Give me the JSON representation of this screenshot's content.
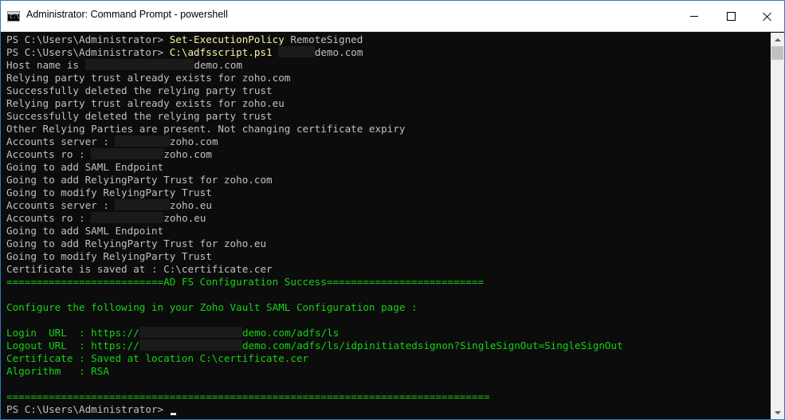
{
  "window": {
    "title": "Administrator: Command Prompt - powershell",
    "icon": "cmd-icon",
    "icon_text": "C:\\"
  },
  "lines": [
    {
      "segments": [
        {
          "text": "PS C:\\Users\\Administrator> "
        },
        {
          "text": "Set-ExecutionPolicy",
          "color": "yellow"
        },
        {
          "text": " RemoteSigned"
        }
      ]
    },
    {
      "segments": [
        {
          "text": "PS C:\\Users\\Administrator> "
        },
        {
          "text": "C:\\adfsscript.ps1",
          "color": "yellow"
        },
        {
          "text": " "
        },
        {
          "redact": 6
        },
        {
          "text": "demo.com"
        }
      ]
    },
    {
      "segments": [
        {
          "text": "Host name is "
        },
        {
          "redact": 18
        },
        {
          "text": "demo.com"
        }
      ]
    },
    {
      "segments": [
        {
          "text": "Relying party trust already exists for zoho.com"
        }
      ]
    },
    {
      "segments": [
        {
          "text": "Successfully deleted the relying party trust"
        }
      ]
    },
    {
      "segments": [
        {
          "text": "Relying party trust already exists for zoho.eu"
        }
      ]
    },
    {
      "segments": [
        {
          "text": "Successfully deleted the relying party trust"
        }
      ]
    },
    {
      "segments": [
        {
          "text": "Other Relying Parties are present. Not changing certificate expiry"
        }
      ]
    },
    {
      "segments": [
        {
          "text": "Accounts server : "
        },
        {
          "redact": 9
        },
        {
          "text": "zoho.com"
        }
      ]
    },
    {
      "segments": [
        {
          "text": "Accounts ro : "
        },
        {
          "redact": 12
        },
        {
          "text": "zoho.com"
        }
      ]
    },
    {
      "segments": [
        {
          "text": "Going to add SAML Endpoint"
        }
      ]
    },
    {
      "segments": [
        {
          "text": "Going to add RelyingParty Trust for zoho.com"
        }
      ]
    },
    {
      "segments": [
        {
          "text": "Going to modify RelyingParty Trust"
        }
      ]
    },
    {
      "segments": [
        {
          "text": "Accounts server : "
        },
        {
          "redact": 9
        },
        {
          "text": "zoho.eu"
        }
      ]
    },
    {
      "segments": [
        {
          "text": "Accounts ro : "
        },
        {
          "redact": 12
        },
        {
          "text": "zoho.eu"
        }
      ]
    },
    {
      "segments": [
        {
          "text": "Going to add SAML Endpoint"
        }
      ]
    },
    {
      "segments": [
        {
          "text": "Going to add RelyingParty Trust for zoho.eu"
        }
      ]
    },
    {
      "segments": [
        {
          "text": "Going to modify RelyingParty Trust"
        }
      ]
    },
    {
      "segments": [
        {
          "text": "Certificate is saved at : C:\\certificate.cer"
        }
      ]
    },
    {
      "segments": [
        {
          "text": "==========================AD FS Configuration Success==========================",
          "color": "green"
        }
      ]
    },
    {
      "segments": []
    },
    {
      "segments": [
        {
          "text": "Configure the following in your Zoho Vault SAML Configuration page :",
          "color": "green"
        }
      ]
    },
    {
      "segments": []
    },
    {
      "segments": [
        {
          "text": "Login  URL  : https://",
          "color": "green"
        },
        {
          "redact": 17
        },
        {
          "text": "demo.com/adfs/ls",
          "color": "green"
        }
      ]
    },
    {
      "segments": [
        {
          "text": "Logout URL  : https://",
          "color": "green"
        },
        {
          "redact": 17
        },
        {
          "text": "demo.com/adfs/ls/idpinitiatedsignon?SingleSignOut=SingleSignOut",
          "color": "green"
        }
      ]
    },
    {
      "segments": [
        {
          "text": "Certificate : Saved at location C:\\certificate.cer",
          "color": "green"
        }
      ]
    },
    {
      "segments": [
        {
          "text": "Algorithm   : RSA",
          "color": "green"
        }
      ]
    },
    {
      "segments": []
    },
    {
      "segments": [
        {
          "text": "================================================================================",
          "color": "green"
        }
      ]
    },
    {
      "segments": [
        {
          "text": "PS C:\\Users\\Administrator> "
        }
      ],
      "cursor": true
    }
  ],
  "colors": {
    "background": "#0c0c0c",
    "text": "#c0c0c0",
    "command": "#f9f1a5",
    "success": "#13d413",
    "redacted": "#1a1a1a"
  },
  "scrollbar": {
    "position_fraction": 0
  }
}
